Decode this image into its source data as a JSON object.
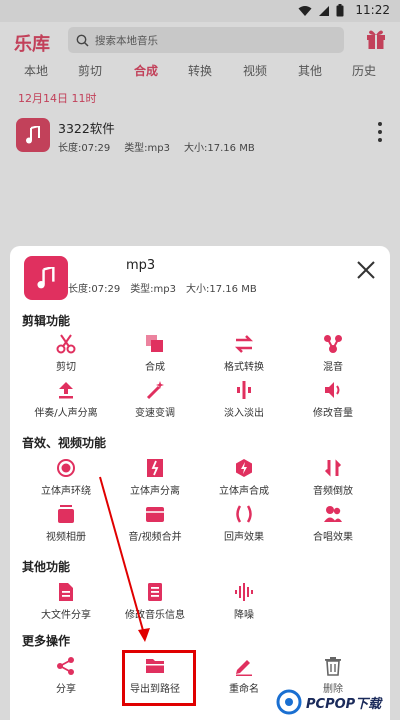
{
  "status_bar": {
    "time": "11:22"
  },
  "header": {
    "title": "乐库",
    "search_placeholder": "搜索本地音乐"
  },
  "tabs": [
    {
      "label": "本地",
      "active": false
    },
    {
      "label": "剪切",
      "active": false
    },
    {
      "label": "合成",
      "active": true
    },
    {
      "label": "转换",
      "active": false
    },
    {
      "label": "视频",
      "active": false
    },
    {
      "label": "其他",
      "active": false
    },
    {
      "label": "历史",
      "active": false
    }
  ],
  "date_line": "12月14日 11时",
  "file": {
    "name": "3322软件",
    "duration": "长度:07:29",
    "type": "类型:mp3",
    "size": "大小:17.16 MB"
  },
  "sheet": {
    "name": "mp3",
    "duration": "长度:07:29",
    "type": "类型:mp3",
    "size": "大小:17.16 MB",
    "sections": [
      {
        "title": "剪辑功能",
        "items": [
          {
            "label": "剪切",
            "icon": "scissors-icon"
          },
          {
            "label": "合成",
            "icon": "merge-icon"
          },
          {
            "label": "格式转换",
            "icon": "convert-arrows-icon"
          },
          {
            "label": "混音",
            "icon": "mix-icon"
          },
          {
            "label": "伴奏/人声分离",
            "icon": "upload-arrow-icon"
          },
          {
            "label": "变速变调",
            "icon": "magic-wand-icon"
          },
          {
            "label": "淡入淡出",
            "icon": "fade-icon"
          },
          {
            "label": "修改音量",
            "icon": "volume-icon"
          }
        ]
      },
      {
        "title": "音效、视频功能",
        "items": [
          {
            "label": "立体声环绕",
            "icon": "surround-icon"
          },
          {
            "label": "立体声分离",
            "icon": "split-icon"
          },
          {
            "label": "立体声合成",
            "icon": "bolt-icon"
          },
          {
            "label": "音频倒放",
            "icon": "reverse-icon"
          },
          {
            "label": "视频相册",
            "icon": "album-icon"
          },
          {
            "label": "音/视频合并",
            "icon": "av-merge-icon"
          },
          {
            "label": "回声效果",
            "icon": "echo-icon"
          },
          {
            "label": "合唱效果",
            "icon": "chorus-icon"
          }
        ]
      },
      {
        "title": "其他功能",
        "items": [
          {
            "label": "大文件分享",
            "icon": "file-share-icon"
          },
          {
            "label": "修改音乐信息",
            "icon": "edit-info-icon"
          },
          {
            "label": "降噪",
            "icon": "noise-wave-icon"
          }
        ]
      },
      {
        "title": "更多操作",
        "items": [
          {
            "label": "分享",
            "icon": "share-icon"
          },
          {
            "label": "导出到路径",
            "icon": "folder-icon"
          },
          {
            "label": "重命名",
            "icon": "pencil-icon"
          },
          {
            "label": "删除",
            "icon": "trash-icon"
          }
        ]
      }
    ]
  },
  "colors": {
    "accent": "#c2415a",
    "icon": "#e0305f",
    "highlight": "#e00000"
  }
}
